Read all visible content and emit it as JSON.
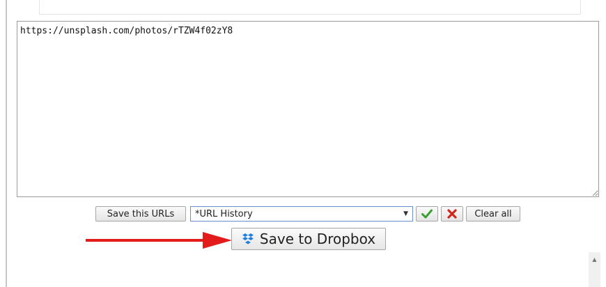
{
  "url_box": {
    "value": "https://unsplash.com/photos/rTZW4f02zY8"
  },
  "toolbar": {
    "save_urls_label": "Save this URLs",
    "history_select": {
      "selected": "*URL History"
    },
    "confirm_icon": "checkmark-icon",
    "delete_icon": "x-icon",
    "clear_all_label": "Clear all"
  },
  "dropbox": {
    "label": "Save to Dropbox",
    "icon": "dropbox-icon"
  },
  "colors": {
    "arrow": "#e31b1b",
    "check": "#3aa02f",
    "delete": "#d0271d",
    "dropbox": "#1f7fe0",
    "select_border": "#6a8fcf"
  }
}
